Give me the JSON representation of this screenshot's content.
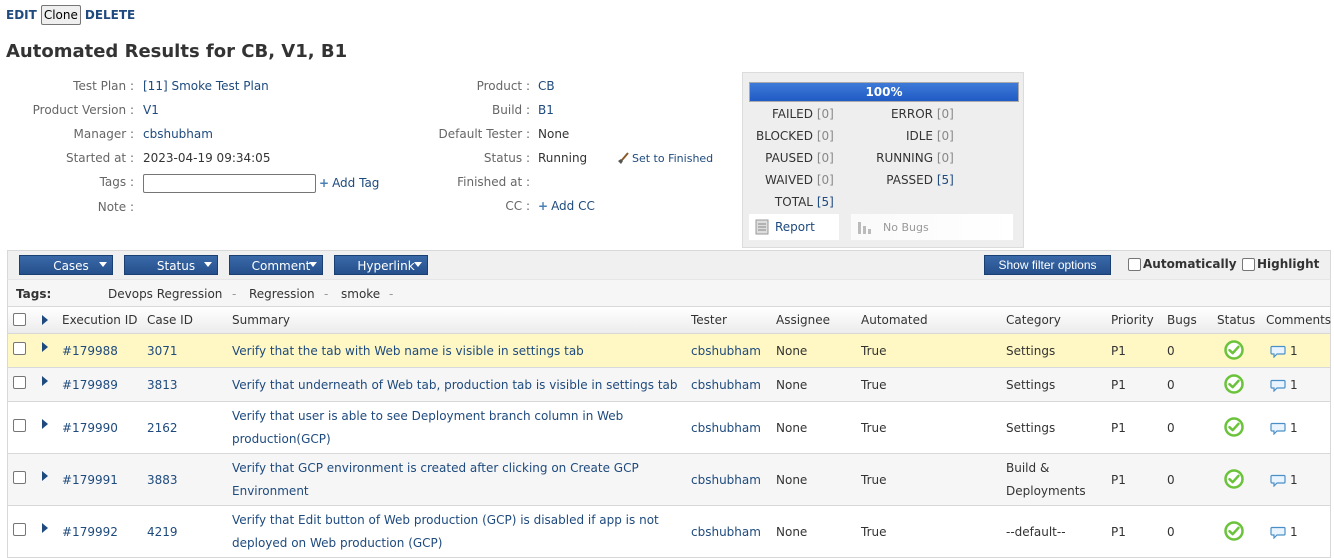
{
  "top_actions": {
    "edit": "EDIT",
    "clone": "Clone",
    "delete": "DELETE"
  },
  "page_title": "Automated Results for CB, V1, B1",
  "info": {
    "test_plan_label": "Test Plan :",
    "test_plan_value": "[11] Smoke Test Plan",
    "product_version_label": "Product Version :",
    "product_version_value": "V1",
    "manager_label": "Manager :",
    "manager_value": "cbshubham",
    "started_label": "Started at :",
    "started_value": "2023-04-19 09:34:05",
    "tags_label": "Tags :",
    "add_tag": "Add Tag",
    "note_label": "Note :",
    "product_label": "Product :",
    "product_value": "CB",
    "build_label": "Build :",
    "build_value": "B1",
    "default_tester_label": "Default Tester :",
    "default_tester_value": "None",
    "status_label": "Status :",
    "status_value": "Running",
    "set_finished": "Set to Finished",
    "finished_label": "Finished at :",
    "cc_label": "CC :",
    "add_cc": "Add CC"
  },
  "progress": {
    "percent": 100,
    "percent_text": "100%",
    "failed_label": "FAILED",
    "failed_count": "[0]",
    "error_label": "ERROR",
    "error_count": "[0]",
    "blocked_label": "BLOCKED",
    "blocked_count": "[0]",
    "idle_label": "IDLE",
    "idle_count": "[0]",
    "paused_label": "PAUSED",
    "paused_count": "[0]",
    "running_label": "RUNNING",
    "running_count": "[0]",
    "waived_label": "WAIVED",
    "waived_count": "[0]",
    "passed_label": "PASSED",
    "passed_count": "[5]",
    "total_label": "TOTAL",
    "total_count": "[5]",
    "report": "Report",
    "no_bugs": "No Bugs"
  },
  "toolbar": {
    "cases": "Cases",
    "status": "Status",
    "comment": "Comment",
    "hyperlink": "Hyperlink",
    "show_filter": "Show filter options",
    "automatically": "Automatically",
    "highlight": "Highlight"
  },
  "tags_bar": {
    "label": "Tags:",
    "tags": [
      "Devops Regression",
      "Regression",
      "smoke"
    ],
    "separator": "-"
  },
  "columns": [
    "Execution ID",
    "Case ID",
    "Summary",
    "Tester",
    "Assignee",
    "Automated",
    "Category",
    "Priority",
    "Bugs",
    "Status",
    "Comments"
  ],
  "rows": [
    {
      "exec_id": "#179988",
      "case_id": "3071",
      "summary": "Verify that the tab with Web name is visible in settings tab",
      "tester": "cbshubham",
      "assignee": "None",
      "automated": "True",
      "category": "Settings",
      "priority": "P1",
      "bugs": "0",
      "comments": "1"
    },
    {
      "exec_id": "#179989",
      "case_id": "3813",
      "summary": "Verify that underneath of Web tab, production tab is visible in settings tab",
      "tester": "cbshubham",
      "assignee": "None",
      "automated": "True",
      "category": "Settings",
      "priority": "P1",
      "bugs": "0",
      "comments": "1"
    },
    {
      "exec_id": "#179990",
      "case_id": "2162",
      "summary": "Verify that user is able to see Deployment branch column in Web production(GCP)",
      "tester": "cbshubham",
      "assignee": "None",
      "automated": "True",
      "category": "Settings",
      "priority": "P1",
      "bugs": "0",
      "comments": "1"
    },
    {
      "exec_id": "#179991",
      "case_id": "3883",
      "summary": "Verify that GCP environment is created after clicking on Create GCP Environment",
      "tester": "cbshubham",
      "assignee": "None",
      "automated": "True",
      "category": "Build & Deployments",
      "priority": "P1",
      "bugs": "0",
      "comments": "1"
    },
    {
      "exec_id": "#179992",
      "case_id": "4219",
      "summary": "Verify that Edit button of Web production (GCP) is disabled if app is not deployed on Web production (GCP)",
      "tester": "cbshubham",
      "assignee": "None",
      "automated": "True",
      "category": "--default--",
      "priority": "P1",
      "bugs": "0",
      "comments": "1"
    }
  ],
  "colors": {
    "link": "#1e4a7d",
    "highlight_row": "#fff8c4",
    "progress": "#2a62c8",
    "pass": "#6ac33b"
  }
}
